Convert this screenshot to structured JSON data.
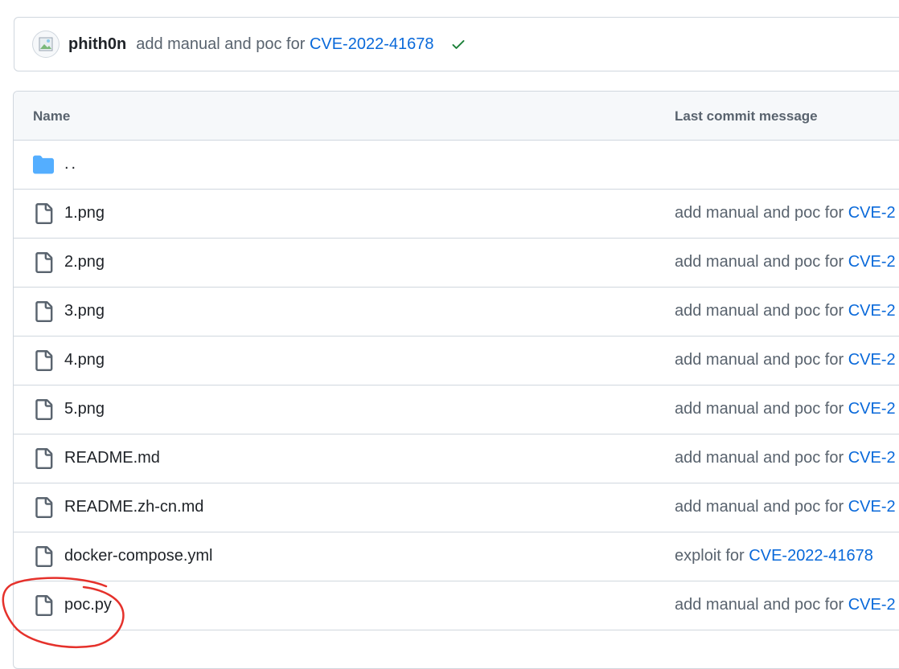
{
  "commit_bar": {
    "author": "phith0n",
    "message": "add manual and poc for",
    "cve_link": "CVE-2022-41678",
    "status_icon": "check-icon",
    "status_color": "#1a7f37"
  },
  "table": {
    "headers": {
      "name": "Name",
      "commit": "Last commit message"
    },
    "parent_label": "..",
    "rows": [
      {
        "name": "1.png",
        "message": "add manual and poc for",
        "link": "CVE-2"
      },
      {
        "name": "2.png",
        "message": "add manual and poc for",
        "link": "CVE-2"
      },
      {
        "name": "3.png",
        "message": "add manual and poc for",
        "link": "CVE-2"
      },
      {
        "name": "4.png",
        "message": "add manual and poc for",
        "link": "CVE-2"
      },
      {
        "name": "5.png",
        "message": "add manual and poc for",
        "link": "CVE-2"
      },
      {
        "name": "README.md",
        "message": "add manual and poc for",
        "link": "CVE-2"
      },
      {
        "name": "README.zh-cn.md",
        "message": "add manual and poc for",
        "link": "CVE-2"
      },
      {
        "name": "docker-compose.yml",
        "message": "exploit for",
        "link": "CVE-2022-41678"
      },
      {
        "name": "poc.py",
        "message": "add manual and poc for",
        "link": "CVE-2"
      }
    ]
  },
  "colors": {
    "link": "#0969da",
    "muted": "#59636e",
    "border": "#d0d7de",
    "folder": "#54aeff",
    "annotation": "#e5312b"
  }
}
